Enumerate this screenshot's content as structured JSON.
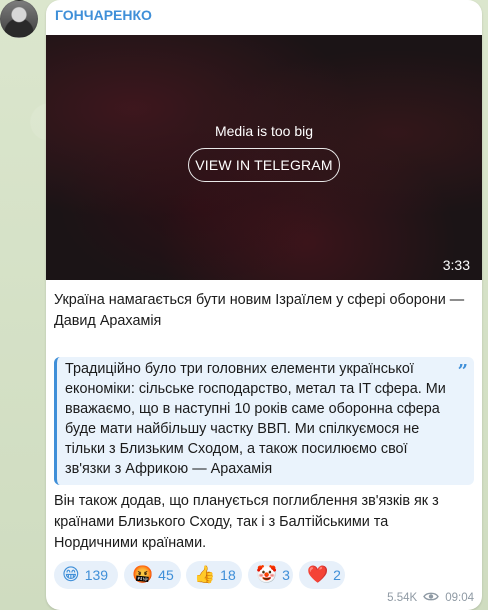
{
  "post": {
    "author": "ГОНЧАРЕНКО",
    "media": {
      "message": "Media is too big",
      "button_label": "VIEW IN TELEGRAM",
      "duration": "3:33"
    },
    "headline": "Україна намагається бути новим Ізраїлем у сфері оборони — Давид Арахамія",
    "quote": "Традиційно було три головних елементи української економіки: сільське господарство, метал та IT сфера. Ми вважаємо, що в наступні 10 років саме оборонна сфера буде мати найбільшу частку ВВП. Ми спілкуємося не тільки з Близьким Сходом, а також посилюємо свої зв'язки з Африкою — Арахамія",
    "body": "Він також додав, що планується поглиблення зв'язків як з країнами Близького Сходу, так і з Балтійськими та Нордичними країнами.",
    "reactions": [
      {
        "emoji": "😁",
        "count": "139"
      },
      {
        "emoji": "🤬",
        "count": "45"
      },
      {
        "emoji": "👍",
        "count": "18"
      },
      {
        "emoji": "🤡",
        "count": "3"
      },
      {
        "emoji": "❤️",
        "count": "2"
      }
    ],
    "views": "5.54K",
    "time": "09:04"
  },
  "icons": {
    "quote": "quote-icon",
    "views": "eye-icon"
  },
  "colors": {
    "accent": "#3f8fd8",
    "reaction_bg": "#e7f0fa",
    "quote_bg": "#eaf3fc"
  }
}
